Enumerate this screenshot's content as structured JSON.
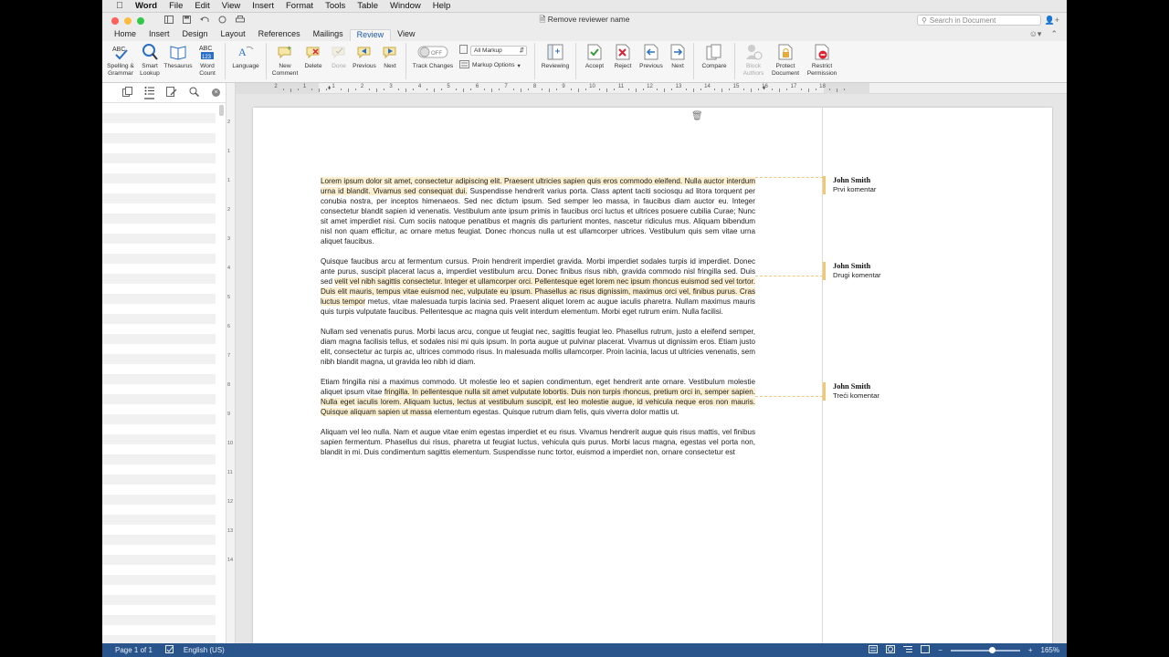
{
  "menubar": {
    "items": [
      "Word",
      "File",
      "Edit",
      "View",
      "Insert",
      "Format",
      "Tools",
      "Table",
      "Window",
      "Help"
    ]
  },
  "window": {
    "title": "Remove reviewer name",
    "search_placeholder": "Search in Document"
  },
  "tabs": [
    "Home",
    "Insert",
    "Design",
    "Layout",
    "References",
    "Mailings",
    "Review",
    "View"
  ],
  "active_tab": "Review",
  "ribbon": {
    "spelling": "Spelling &",
    "spelling2": "Grammar",
    "smart": "Smart",
    "smart2": "Lookup",
    "thesaurus": "Thesaurus",
    "wordcount": "Word",
    "wordcount2": "Count",
    "language": "Language",
    "newcomment": "New",
    "newcomment2": "Comment",
    "delete": "Delete",
    "done": "Done",
    "previous": "Previous",
    "next": "Next",
    "track_toggle": "OFF",
    "track_changes": "Track Changes",
    "markup_select": "All Markup",
    "markup_options": "Markup Options",
    "reviewing": "Reviewing",
    "accept": "Accept",
    "reject": "Reject",
    "previous2": "Previous",
    "next2": "Next",
    "compare": "Compare",
    "block": "Block",
    "block2": "Authors",
    "protect": "Protect",
    "protect2": "Document",
    "restrict": "Restrict",
    "restrict2": "Permission"
  },
  "ruler": {
    "numbers": [
      "2",
      "1",
      "1",
      "2",
      "3",
      "4",
      "5",
      "6",
      "7",
      "8",
      "9",
      "10",
      "11",
      "12",
      "13",
      "14",
      "15",
      "16",
      "17",
      "18"
    ],
    "vnumbers": [
      "2",
      "1",
      "1",
      "2",
      "3",
      "4",
      "5",
      "6",
      "7",
      "8",
      "9",
      "10",
      "11",
      "12",
      "13",
      "14"
    ]
  },
  "document": {
    "p1": {
      "hl": "Lorem ipsum dolor sit amet, consectetur adipiscing elit. Praesent ultricies sapien quis eros commodo eleifend. Nulla auctor interdum urna id blandit. Vivamus sed consequat dui.",
      "rest": " Suspendisse hendrerit varius porta. Class aptent taciti sociosqu ad litora torquent per conubia nostra, per inceptos himenaeos. Sed nec dictum ipsum. Sed semper leo massa, in faucibus diam auctor eu. Integer consectetur blandit sapien id venenatis. Vestibulum ante ipsum primis in faucibus orci luctus et ultrices posuere cubilia Curae; Nunc sit amet imperdiet nisi. Cum sociis natoque penatibus et magnis dis parturient montes, nascetur ridiculus mus. Aliquam bibendum nisl non quam efficitur, ac ornare metus feugiat. Donec rhoncus nulla ut est ullamcorper ultrices. Vestibulum quis sem vitae urna aliquet faucibus."
    },
    "p2": {
      "pre": "Quisque faucibus arcu at fermentum cursus. Proin hendrerit imperdiet gravida. Morbi imperdiet sodales turpis id imperdiet. Donec ante purus, suscipit placerat lacus a, imperdiet vestibulum arcu. Donec finibus risus nibh, gravida commodo nisl fringilla sed. Duis sed ",
      "hl": "velit vel nibh sagittis consectetur. Integer et ullamcorper orci. Pellentesque eget lorem nec ipsum rhoncus euismod sed vel tortor. Duis elit mauris, tempus vitae euismod nec, vulputate eu ipsum. Phasellus ac risus dignissim, maximus orci vel, finibus purus. Cras luctus tempor",
      "rest": " metus, vitae malesuada turpis lacinia sed. Praesent aliquet lorem ac augue iaculis pharetra. Nullam maximus mauris quis turpis vulputate faucibus. Pellentesque ac magna quis velit interdum elementum. Morbi eget rutrum enim. Nulla facilisi."
    },
    "p3": "Nullam sed venenatis purus. Morbi lacus arcu, congue ut feugiat nec, sagittis feugiat leo. Phasellus rutrum, justo a eleifend semper, diam magna facilisis tellus, et sodales nisi mi quis ipsum. In porta augue ut pulvinar placerat. Vivamus ut dignissim eros. Etiam justo elit, consectetur ac turpis ac, ultrices commodo risus. In malesuada mollis ullamcorper. Proin lacinia, lacus ut ultricies venenatis, sem nibh blandit magna, ut gravida leo nibh id diam.",
    "p4": {
      "pre": "Etiam fringilla nisi a maximus commodo. Ut molestie leo et sapien condimentum, eget hendrerit ante ornare. Vestibulum molestie aliquet ipsum vitae ",
      "hl": "fringilla. In pellentesque nulla sit amet vulputate lobortis. Duis non turpis rhoncus, pretium orci in, semper sapien. Nulla eget iaculis lorem. Aliquam luctus, lectus at vestibulum suscipit, est leo molestie augue, id vehicula neque eros non mauris. Quisque aliquam sapien ut massa",
      "rest": " elementum egestas. Quisque rutrum diam felis, quis viverra dolor mattis ut."
    },
    "p5": "Aliquam vel leo nulla. Nam et augue vitae enim egestas imperdiet et eu risus. Vivamus hendrerit augue quis risus mattis, vel finibus sapien fermentum. Phasellus dui risus, pharetra ut feugiat luctus, vehicula quis purus. Morbi lacus magna, egestas vel porta non, blandit in mi. Duis condimentum sagittis elementum. Suspendisse nunc tortor, euismod a imperdiet non, ornare consectetur est"
  },
  "comments": [
    {
      "author": "John Smith",
      "text": "Prvi komentar"
    },
    {
      "author": "John Smith",
      "text": "Drugi komentar"
    },
    {
      "author": "John Smith",
      "text": "Treći komentar"
    }
  ],
  "statusbar": {
    "page": "Page 1 of 1",
    "language": "English (US)",
    "zoom": "165%"
  },
  "colors": {
    "accent": "#1f5aa8",
    "statusbar": "#2a558c",
    "highlight": "#fbefcf",
    "comment_bar": "#f1c870"
  }
}
